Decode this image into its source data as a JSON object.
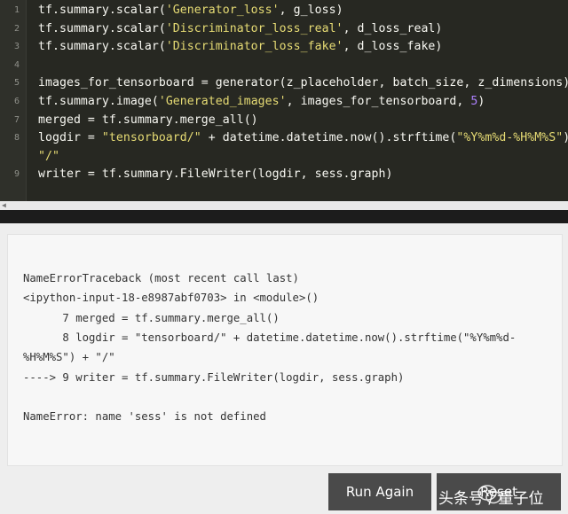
{
  "editor": {
    "lines": [
      {
        "n": "1",
        "code": [
          {
            "t": "tf.summary.scalar("
          },
          {
            "t": "'Generator_loss'",
            "cls": "str"
          },
          {
            "t": ", g_loss)"
          }
        ]
      },
      {
        "n": "2",
        "code": [
          {
            "t": "tf.summary.scalar("
          },
          {
            "t": "'Discriminator_loss_real'",
            "cls": "str"
          },
          {
            "t": ", d_loss_real)"
          }
        ]
      },
      {
        "n": "3",
        "code": [
          {
            "t": "tf.summary.scalar("
          },
          {
            "t": "'Discriminator_loss_fake'",
            "cls": "str"
          },
          {
            "t": ", d_loss_fake)"
          }
        ]
      },
      {
        "n": "4",
        "code": []
      },
      {
        "n": "5",
        "code": [
          {
            "t": "images_for_tensorboard = generator(z_placeholder, batch_size, z_dimensions)"
          }
        ]
      },
      {
        "n": "6",
        "code": [
          {
            "t": "tf.summary.image("
          },
          {
            "t": "'Generated_images'",
            "cls": "str"
          },
          {
            "t": ", images_for_tensorboard, "
          },
          {
            "t": "5",
            "cls": "num"
          },
          {
            "t": ")"
          }
        ]
      },
      {
        "n": "7",
        "code": [
          {
            "t": "merged = tf.summary.merge_all()"
          }
        ]
      },
      {
        "n": "8",
        "code": [
          {
            "t": "logdir = "
          },
          {
            "t": "\"tensorboard/\"",
            "cls": "str"
          },
          {
            "t": " + datetime.datetime.now().strftime("
          },
          {
            "t": "\"%Y%m%d-%H%M%S\"",
            "cls": "str"
          },
          {
            "t": ") +"
          }
        ]
      },
      {
        "n": "",
        "code": [
          {
            "t": "\"/\"",
            "cls": "str"
          }
        ]
      },
      {
        "n": "9",
        "code": [
          {
            "t": "writer = tf.summary.FileWriter(logdir, sess.graph)"
          }
        ]
      }
    ]
  },
  "output": {
    "lines": [
      "NameErrorTraceback (most recent call last)",
      "<ipython-input-18-e8987abf0703> in <module>()",
      "      7 merged = tf.summary.merge_all()",
      "      8 logdir = \"tensorboard/\" + datetime.datetime.now().strftime(\"%Y%m%d-",
      "%H%M%S\") + \"/\"",
      "----> 9 writer = tf.summary.FileWriter(logdir, sess.graph)",
      "",
      "NameError: name 'sess' is not defined"
    ]
  },
  "buttons": {
    "run_label": "Run Again",
    "reset_label": "Reset"
  },
  "watermark": {
    "text": "头条号 / 量子位"
  },
  "icons": {
    "scroll_left": "left-arrow-icon",
    "watermark_logo": "wechat-icon"
  },
  "colors": {
    "editor_bg": "#272822",
    "string": "#e6db74",
    "number": "#ae81ff",
    "button_bg": "#4a4a4a"
  }
}
